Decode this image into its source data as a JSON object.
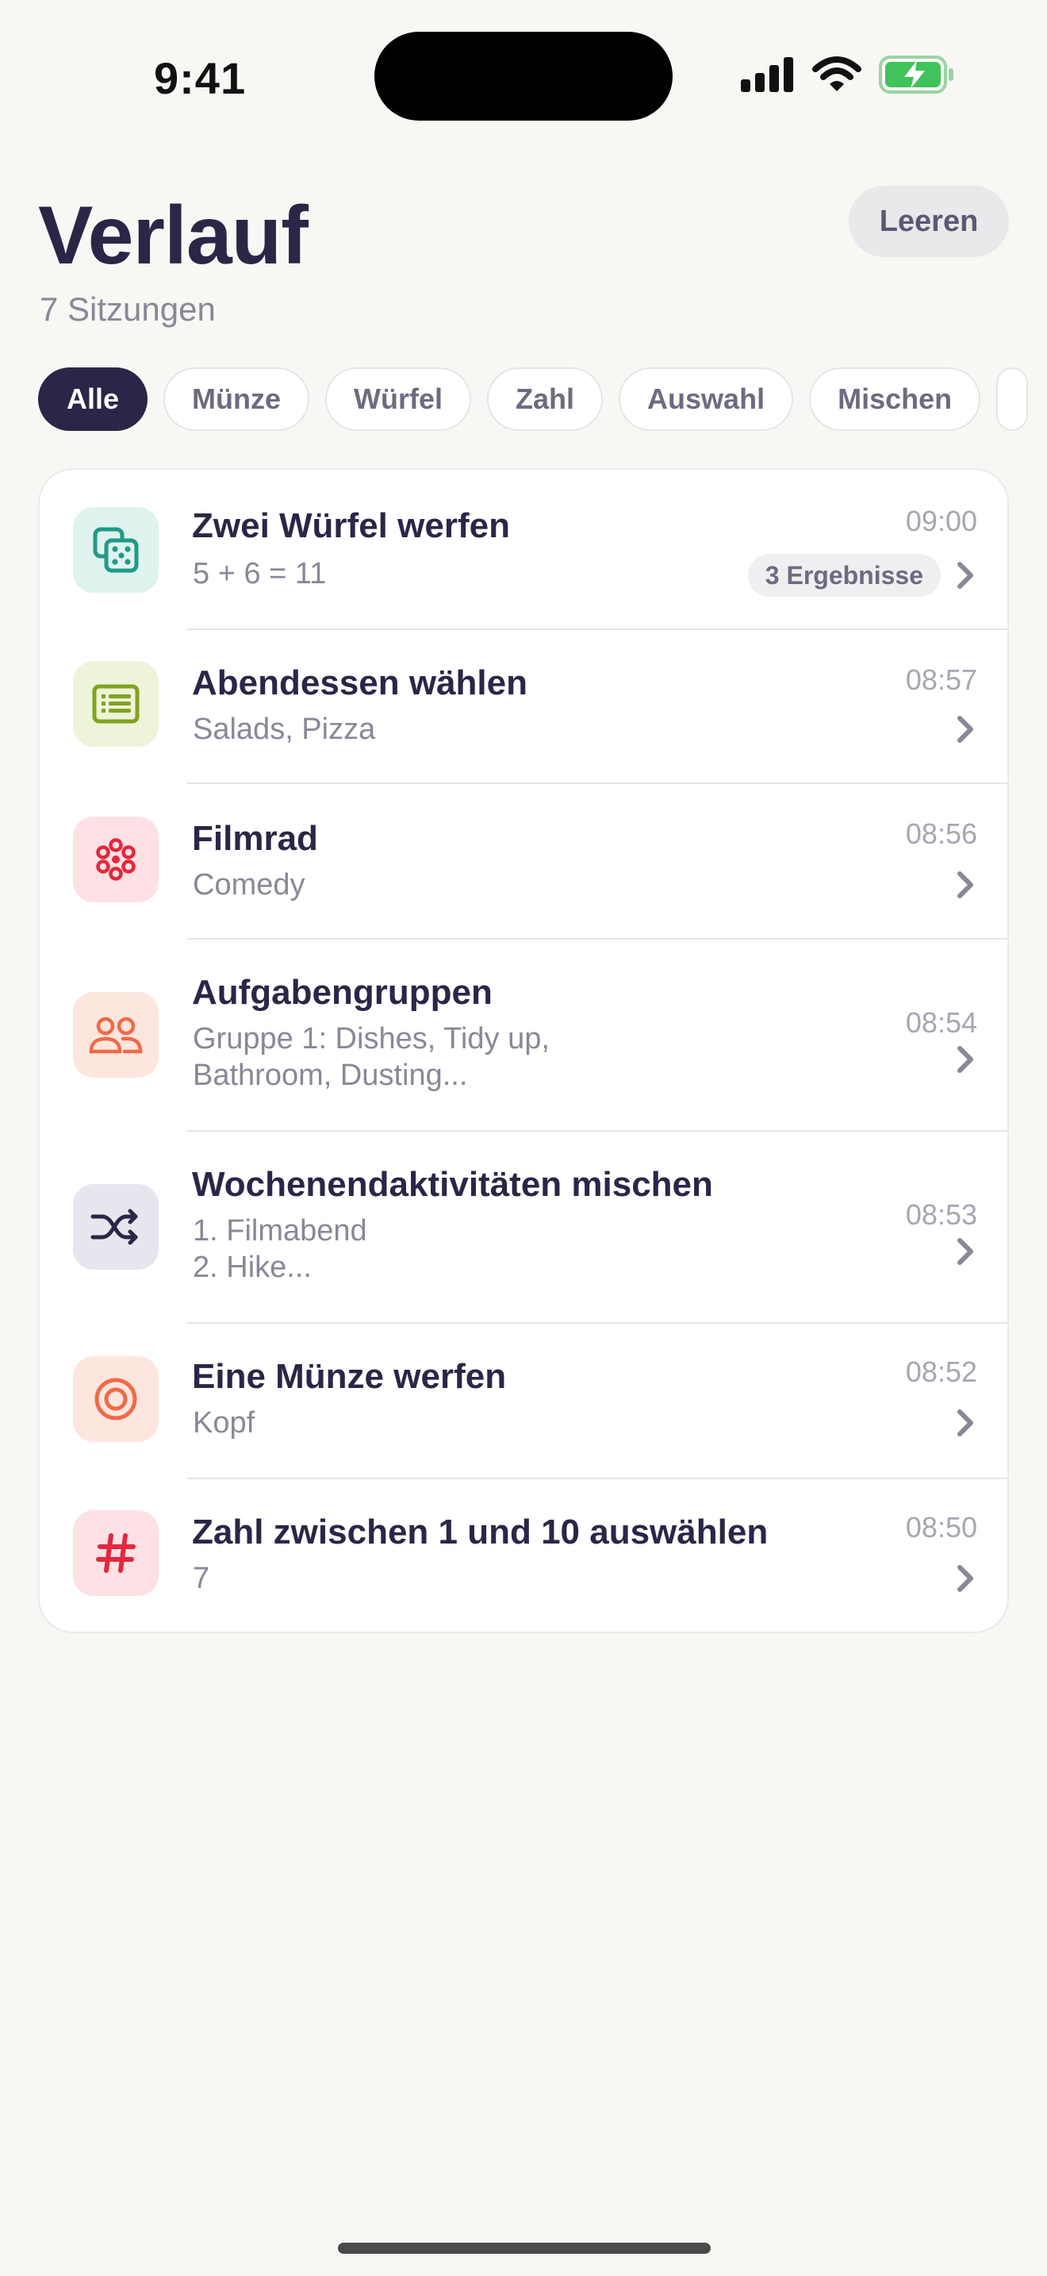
{
  "status_bar": {
    "time": "9:41"
  },
  "header": {
    "title": "Verlauf",
    "subtitle": "7 Sitzungen",
    "clear_label": "Leeren"
  },
  "filters": [
    "Alle",
    "Münze",
    "Würfel",
    "Zahl",
    "Auswahl",
    "Mischen"
  ],
  "colors": {
    "primary": "#2b2647",
    "background": "#f8f7f4",
    "muted": "#8a8798"
  },
  "sessions": [
    {
      "icon": "dice-icon",
      "title": "Zwei Würfel werfen",
      "line1": "5 + 6 = 11",
      "line2": "",
      "time": "09:00",
      "badge": "3 Ergebnisse"
    },
    {
      "icon": "list-icon",
      "title": "Abendessen wählen",
      "line1": "Salads, Pizza",
      "line2": "",
      "time": "08:57",
      "badge": ""
    },
    {
      "icon": "wheel-icon",
      "title": "Filmrad",
      "line1": "Comedy",
      "line2": "",
      "time": "08:56",
      "badge": ""
    },
    {
      "icon": "people-icon",
      "title": "Aufgabengruppen",
      "line1": "Gruppe 1: Dishes, Tidy up,",
      "line2": "Bathroom, Dusting...",
      "time": "08:54",
      "badge": ""
    },
    {
      "icon": "shuffle-icon",
      "title": "Wochenendaktivitäten mischen",
      "line1": "1. Filmabend",
      "line2": "2. Hike...",
      "time": "08:53",
      "badge": ""
    },
    {
      "icon": "coin-icon",
      "title": "Eine Münze werfen",
      "line1": "Kopf",
      "line2": "",
      "time": "08:52",
      "badge": ""
    },
    {
      "icon": "hash-icon",
      "title": "Zahl zwischen 1 und 10 auswählen",
      "line1": "7",
      "line2": "",
      "time": "08:50",
      "badge": ""
    }
  ]
}
